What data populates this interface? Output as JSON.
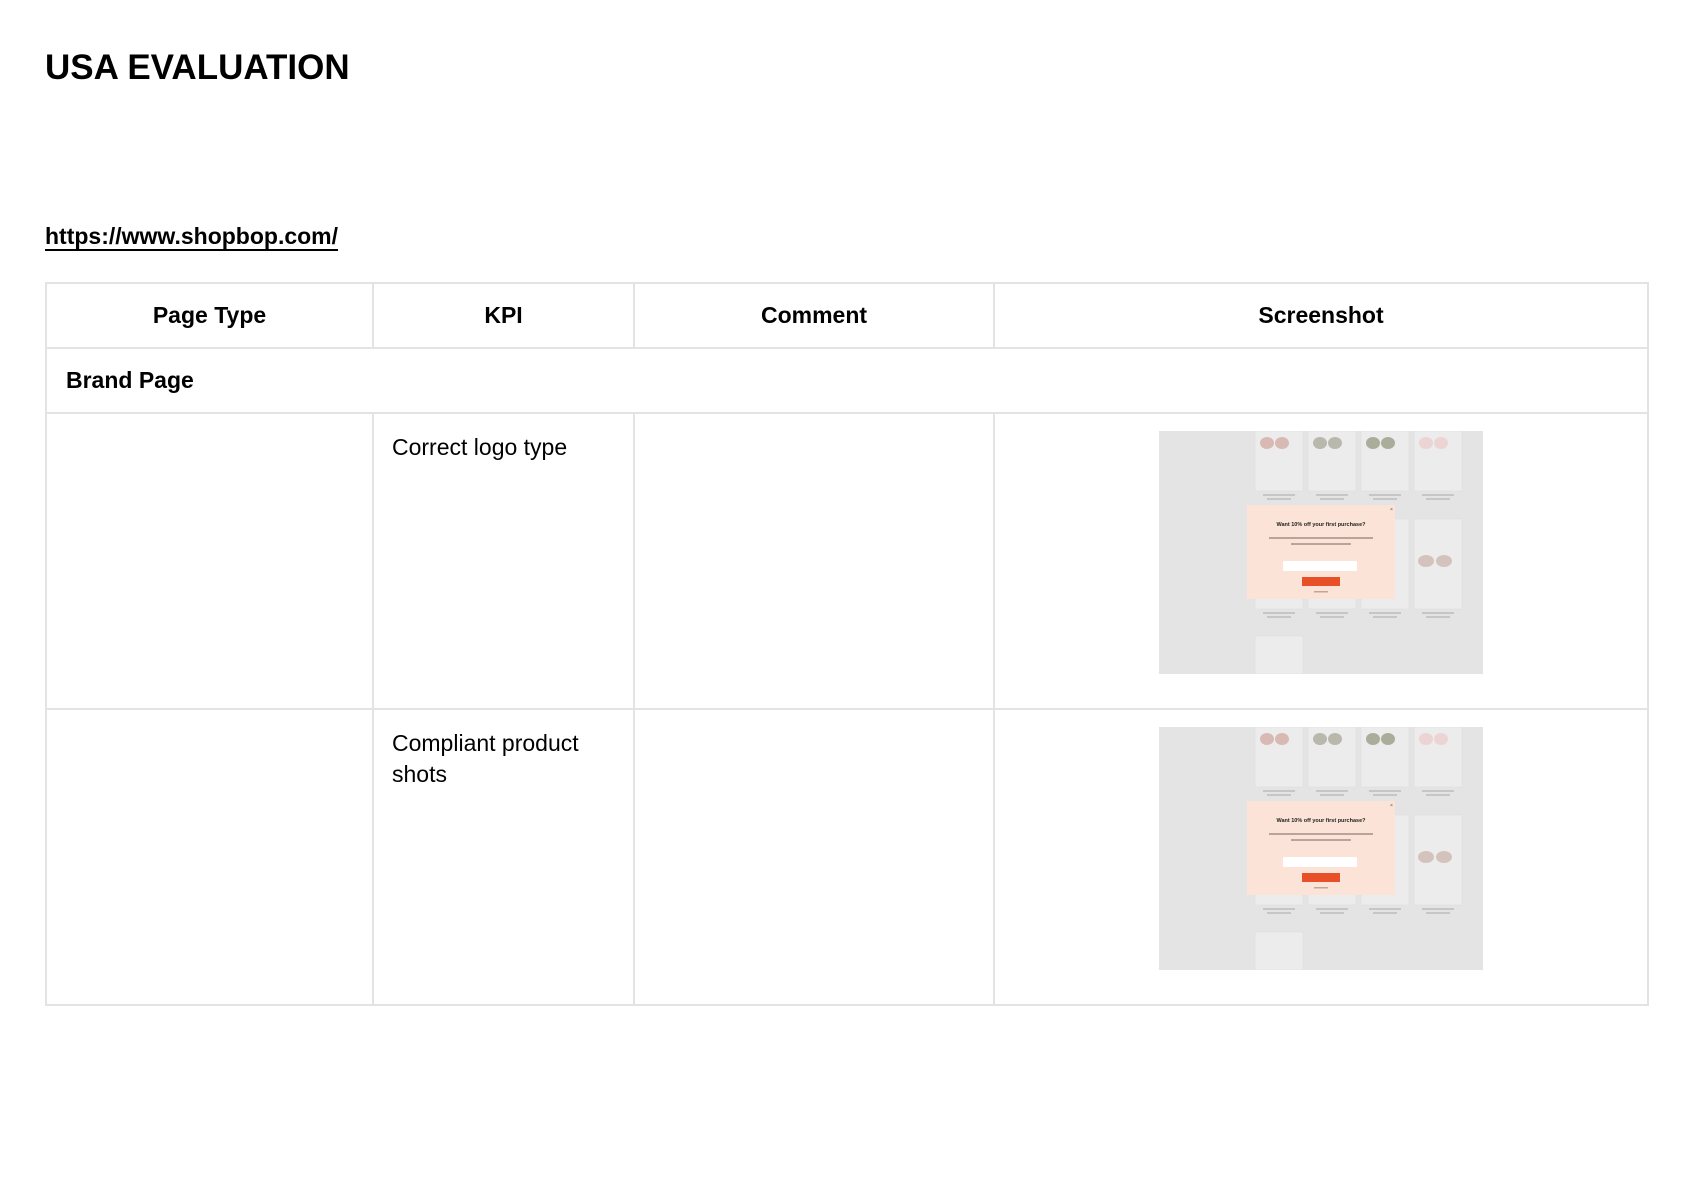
{
  "document": {
    "title": "USA EVALUATION",
    "url": "https://www.shopbop.com/"
  },
  "table": {
    "headers": [
      "Page Type",
      "KPI",
      "Comment",
      "Screenshot"
    ],
    "section": "Brand Page",
    "rows": [
      {
        "page_type": "",
        "kpi": "Correct logo type",
        "comment": "",
        "screenshot": "shopbop-brand-page-popup-screenshot"
      },
      {
        "page_type": "",
        "kpi": "Compliant product shots",
        "comment": "",
        "screenshot": "shopbop-brand-page-popup-screenshot"
      }
    ]
  },
  "screenshot_thumbnail": {
    "popup_heading": "Want 10% off your first purchase?",
    "colors": {
      "background": "#e4e4e4",
      "popup": "#fce3d8",
      "button": "#e8502a"
    }
  }
}
